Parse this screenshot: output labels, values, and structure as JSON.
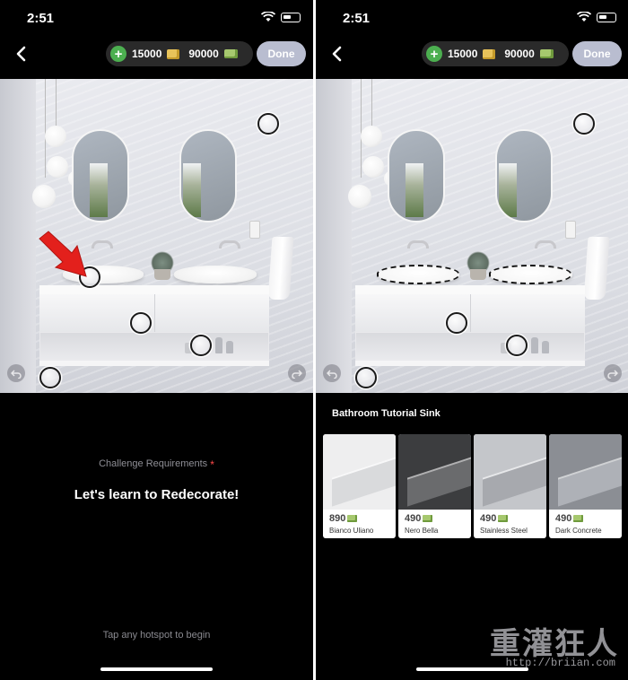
{
  "status_bar": {
    "time": "2:51"
  },
  "header": {
    "coins": "15000",
    "cash": "90000",
    "done_label": "Done"
  },
  "icons": [
    "back-chevron-icon",
    "plus-icon",
    "coin-icon",
    "cash-icon",
    "wifi-icon",
    "battery-icon",
    "undo-icon",
    "redo-icon",
    "pointer-arrow-icon"
  ],
  "left_panel": {
    "challenge_label": "Challenge Requirements",
    "required_mark": "*",
    "challenge_title": "Let's learn to Redecorate!",
    "hint": "Tap any hotspot to begin"
  },
  "right_panel": {
    "section_title": "Bathroom Tutorial Sink",
    "materials": [
      {
        "price": "890",
        "name": "Bianco Uliano",
        "swatch": "#eeeeef",
        "edge": "#d9dadc"
      },
      {
        "price": "490",
        "name": "Nero Bella",
        "swatch": "#3c3d3f",
        "edge": "#6a6b6d"
      },
      {
        "price": "490",
        "name": "Stainless Steel",
        "swatch": "#c4c6ca",
        "edge": "#a7a9ae"
      },
      {
        "price": "490",
        "name": "Dark Concrete",
        "swatch": "#8b8e94",
        "edge": "#aeb1b7"
      }
    ]
  },
  "colors": {
    "accent_green": "#4caf50",
    "done_button": "#b9bdd0",
    "required_star": "#ff4a4a",
    "pointer_arrow": "#e3201c"
  },
  "watermark": {
    "text": "重灌狂人",
    "url": "http://briian.com"
  }
}
